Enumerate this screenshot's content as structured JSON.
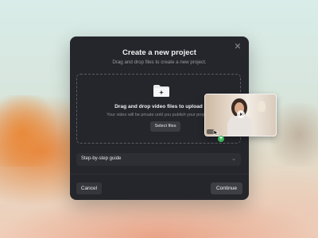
{
  "modal": {
    "title": "Create a new project",
    "subtitle": "Drag and drop files to create a new project.",
    "close_icon": "close-icon"
  },
  "dropzone": {
    "icon": "folder-upload-icon",
    "title": "Drag and drop video files to upload",
    "subtitle": "Your video will be private until you publish your project.",
    "select_label": "Select files"
  },
  "guide": {
    "label": "Step-by-step guide",
    "chevron_icon": "chevron-down-icon"
  },
  "footer": {
    "cancel_label": "Cancel",
    "continue_label": "Continue"
  },
  "dragged_file": {
    "type": "video",
    "badge": "+",
    "badge_color": "#3bb55c"
  },
  "colors": {
    "modal_bg": "#25262b",
    "accent_badge": "#3bb55c"
  }
}
